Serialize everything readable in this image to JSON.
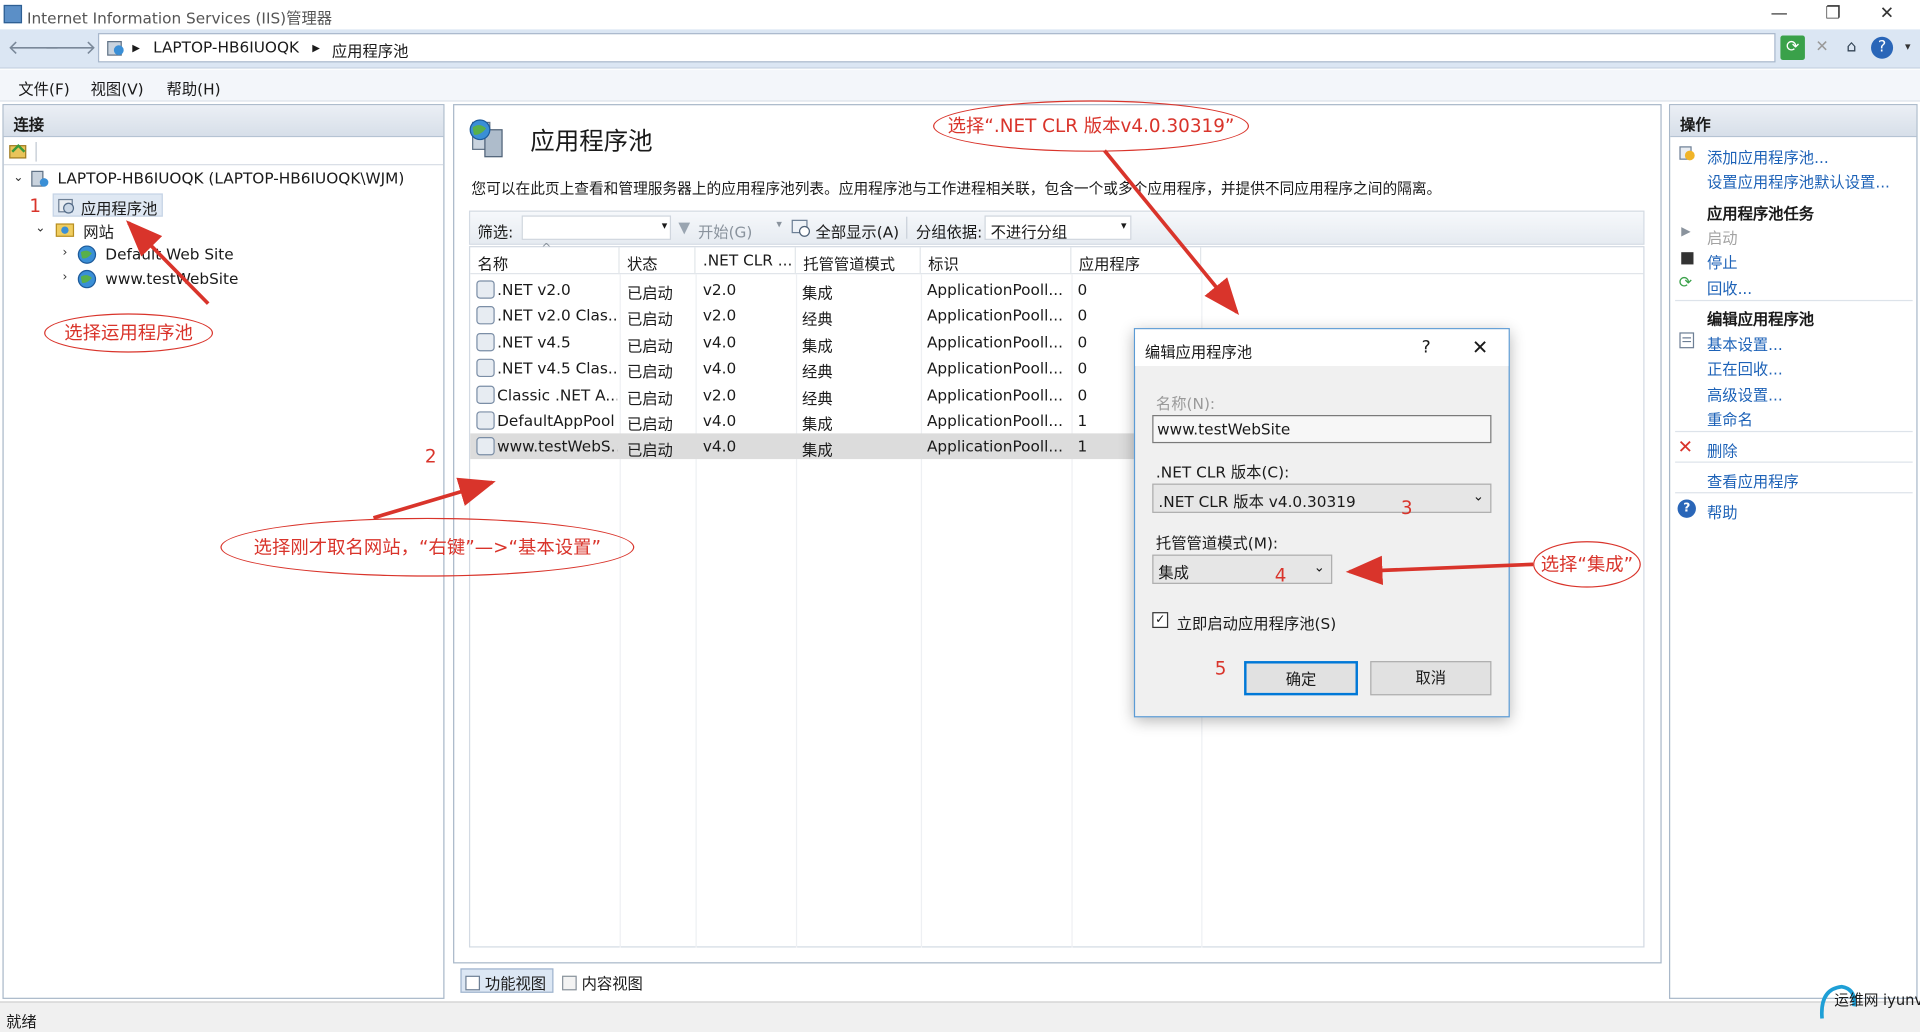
{
  "window": {
    "title": "Internet Information Services (IIS)管理器"
  },
  "address": {
    "crumbs": [
      "LAPTOP-HB6IUOQK",
      "应用程序池"
    ]
  },
  "menu": [
    "文件(F)",
    "视图(V)",
    "帮助(H)"
  ],
  "connections": {
    "header": "连接",
    "tree": [
      {
        "label": "LAPTOP-HB6IUOQK (LAPTOP-HB6IUOQK\\WJM)"
      },
      {
        "label": "应用程序池"
      },
      {
        "label": "网站"
      },
      {
        "label": "Default Web Site"
      },
      {
        "label": "www.testWebSite"
      }
    ]
  },
  "main": {
    "title": "应用程序池",
    "description": "您可以在此页上查看和管理服务器上的应用程序池列表。应用程序池与工作进程相关联，包含一个或多个应用程序，并提供不同应用程序之间的隔离。",
    "filter_label": "筛选:",
    "start_label": "开始(G)",
    "show_all_label": "全部显示(A)",
    "group_label": "分组依据:",
    "group_value": "不进行分组",
    "columns": [
      "名称",
      "状态",
      ".NET CLR ...",
      "托管管道模式",
      "标识",
      "应用程序"
    ],
    "rows": [
      [
        ".NET v2.0",
        "已启动",
        "v2.0",
        "集成",
        "ApplicationPooll...",
        "0"
      ],
      [
        ".NET v2.0 Clas...",
        "已启动",
        "v2.0",
        "经典",
        "ApplicationPooll...",
        "0"
      ],
      [
        ".NET v4.5",
        "已启动",
        "v4.0",
        "集成",
        "ApplicationPooll...",
        "0"
      ],
      [
        ".NET v4.5 Clas...",
        "已启动",
        "v4.0",
        "经典",
        "ApplicationPooll...",
        "0"
      ],
      [
        "Classic .NET A...",
        "已启动",
        "v2.0",
        "经典",
        "ApplicationPooll...",
        "0"
      ],
      [
        "DefaultAppPool",
        "已启动",
        "v4.0",
        "集成",
        "ApplicationPooll...",
        "1"
      ],
      [
        "www.testWebS...",
        "已启动",
        "v4.0",
        "集成",
        "ApplicationPooll...",
        "1"
      ]
    ],
    "tabs": [
      "功能视图",
      "内容视图"
    ]
  },
  "actions": {
    "header": "操作",
    "add_pool": "添加应用程序池...",
    "set_defaults": "设置应用程序池默认设置...",
    "tasks_title": "应用程序池任务",
    "start": "启动",
    "stop": "停止",
    "recycle": "回收...",
    "edit_title": "编辑应用程序池",
    "basic": "基本设置...",
    "recycling": "正在回收...",
    "advanced": "高级设置...",
    "rename": "重命名",
    "delete": "删除",
    "view_apps": "查看应用程序",
    "help": "帮助"
  },
  "dialog": {
    "title": "编辑应用程序池",
    "help": "?",
    "name_label": "名称(N):",
    "name_value": "www.testWebSite",
    "clr_label": ".NET CLR 版本(C):",
    "clr_value": ".NET CLR 版本 v4.0.30319",
    "pipeline_label": "托管管道模式(M):",
    "pipeline_value": "集成",
    "autostart_label": "立即启动应用程序池(S)",
    "ok": "确定",
    "cancel": "取消"
  },
  "annotations": {
    "a1": "选择运用程序池",
    "a2": "选择刚才取名网站，“右键”—>“基本设置”",
    "a3": "选择“.NET CLR 版本v4.0.30319”",
    "a4": "选择“集成”",
    "n1": "1",
    "n2": "2",
    "n3": "3",
    "n4": "4",
    "n5": "5"
  },
  "status": {
    "text": "就绪"
  },
  "watermark": "运维网 iyunv.com",
  "colors": {
    "accent": "#1d62b7",
    "annotation": "#d9342b",
    "selection": "#cce8ff"
  }
}
